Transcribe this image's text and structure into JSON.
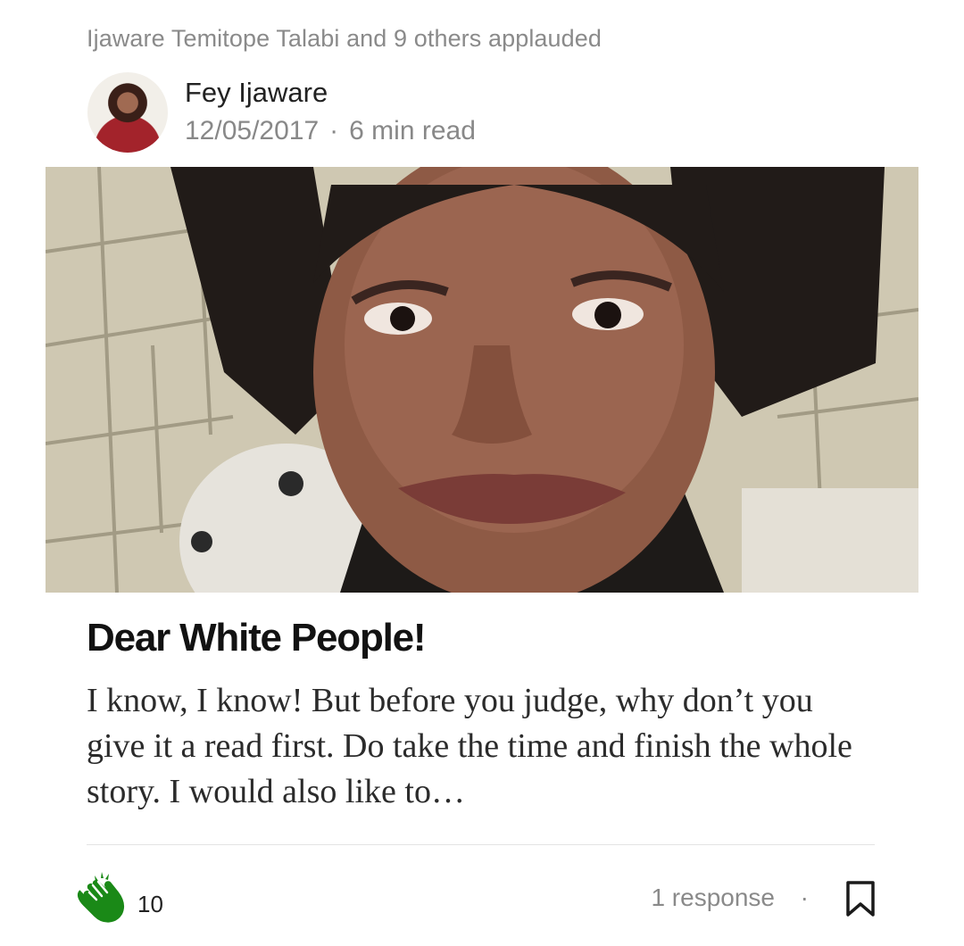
{
  "activity": {
    "applauded_text": "Ijaware Temitope Talabi and 9 others applauded"
  },
  "author": {
    "name": "Fey Ijaware",
    "date": "12/05/2017",
    "separator": "·",
    "read_time": "6 min read"
  },
  "story": {
    "title": "Dear White People!",
    "excerpt": "I know, I know! But before you judge, why don’t you give it a read first. Do take the time and finish the whole story. I would also like to…"
  },
  "footer": {
    "clap_count": "10",
    "responses": "1 response",
    "separator": "·"
  },
  "colors": {
    "clap_green": "#1a8917",
    "meta_gray": "#8a8a8a",
    "title_black": "#121212"
  },
  "icons": {
    "clap": "clap-hands-icon",
    "bookmark": "bookmark-icon"
  }
}
